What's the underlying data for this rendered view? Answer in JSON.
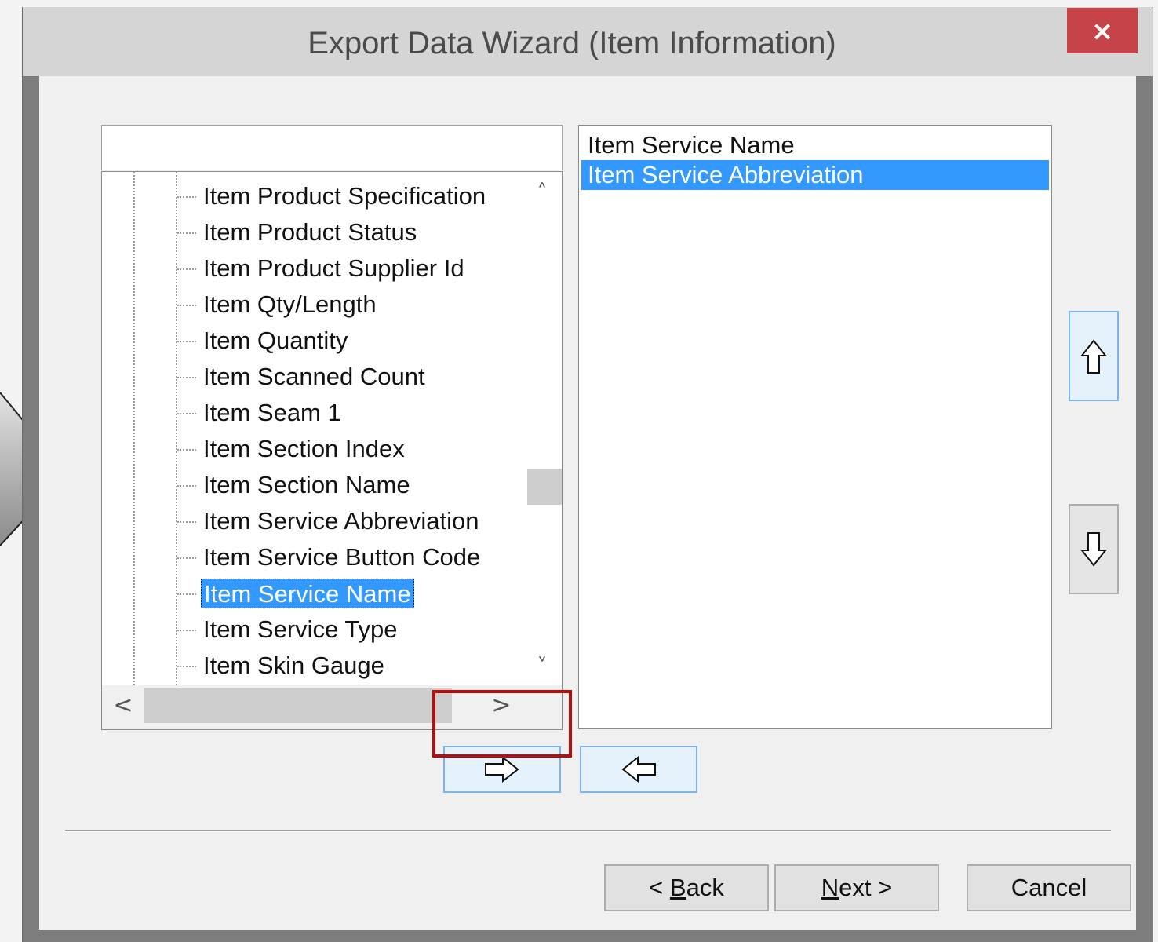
{
  "window": {
    "title": "Export Data Wizard (Item Information)",
    "close_glyph": "×"
  },
  "search": {
    "value": "",
    "placeholder": ""
  },
  "tree": {
    "items": [
      {
        "label": "Item Product Specification",
        "selected": false
      },
      {
        "label": "Item Product Status",
        "selected": false
      },
      {
        "label": "Item Product Supplier Id",
        "selected": false
      },
      {
        "label": "Item Qty/Length",
        "selected": false
      },
      {
        "label": "Item Quantity",
        "selected": false
      },
      {
        "label": "Item Scanned Count",
        "selected": false
      },
      {
        "label": "Item Seam 1",
        "selected": false
      },
      {
        "label": "Item Section Index",
        "selected": false
      },
      {
        "label": "Item Section Name",
        "selected": false
      },
      {
        "label": "Item Service Abbreviation",
        "selected": false
      },
      {
        "label": "Item Service Button Code",
        "selected": false
      },
      {
        "label": "Item Service Name",
        "selected": true
      },
      {
        "label": "Item Service Type",
        "selected": false
      },
      {
        "label": "Item Skin Gauge",
        "selected": false
      }
    ],
    "vscroll_up": "˄",
    "vscroll_down": "˅",
    "hscroll_left": "<",
    "hscroll_right": ">"
  },
  "selected_list": {
    "items": [
      {
        "label": "Item Service Name",
        "selected": false
      },
      {
        "label": "Item Service Abbreviation",
        "selected": true
      }
    ]
  },
  "icons": {
    "add": "arrow-right-icon",
    "remove": "arrow-left-icon",
    "move_up": "arrow-up-icon",
    "move_down": "arrow-down-icon"
  },
  "footer": {
    "back_prefix": "< ",
    "back_mnemonic": "B",
    "back_rest": "ack",
    "next_mnemonic": "N",
    "next_rest": "ext >",
    "cancel_label": "Cancel"
  },
  "colors": {
    "selection": "#3399ff",
    "close_button": "#c7434a",
    "highlight": "#b40f0f"
  }
}
